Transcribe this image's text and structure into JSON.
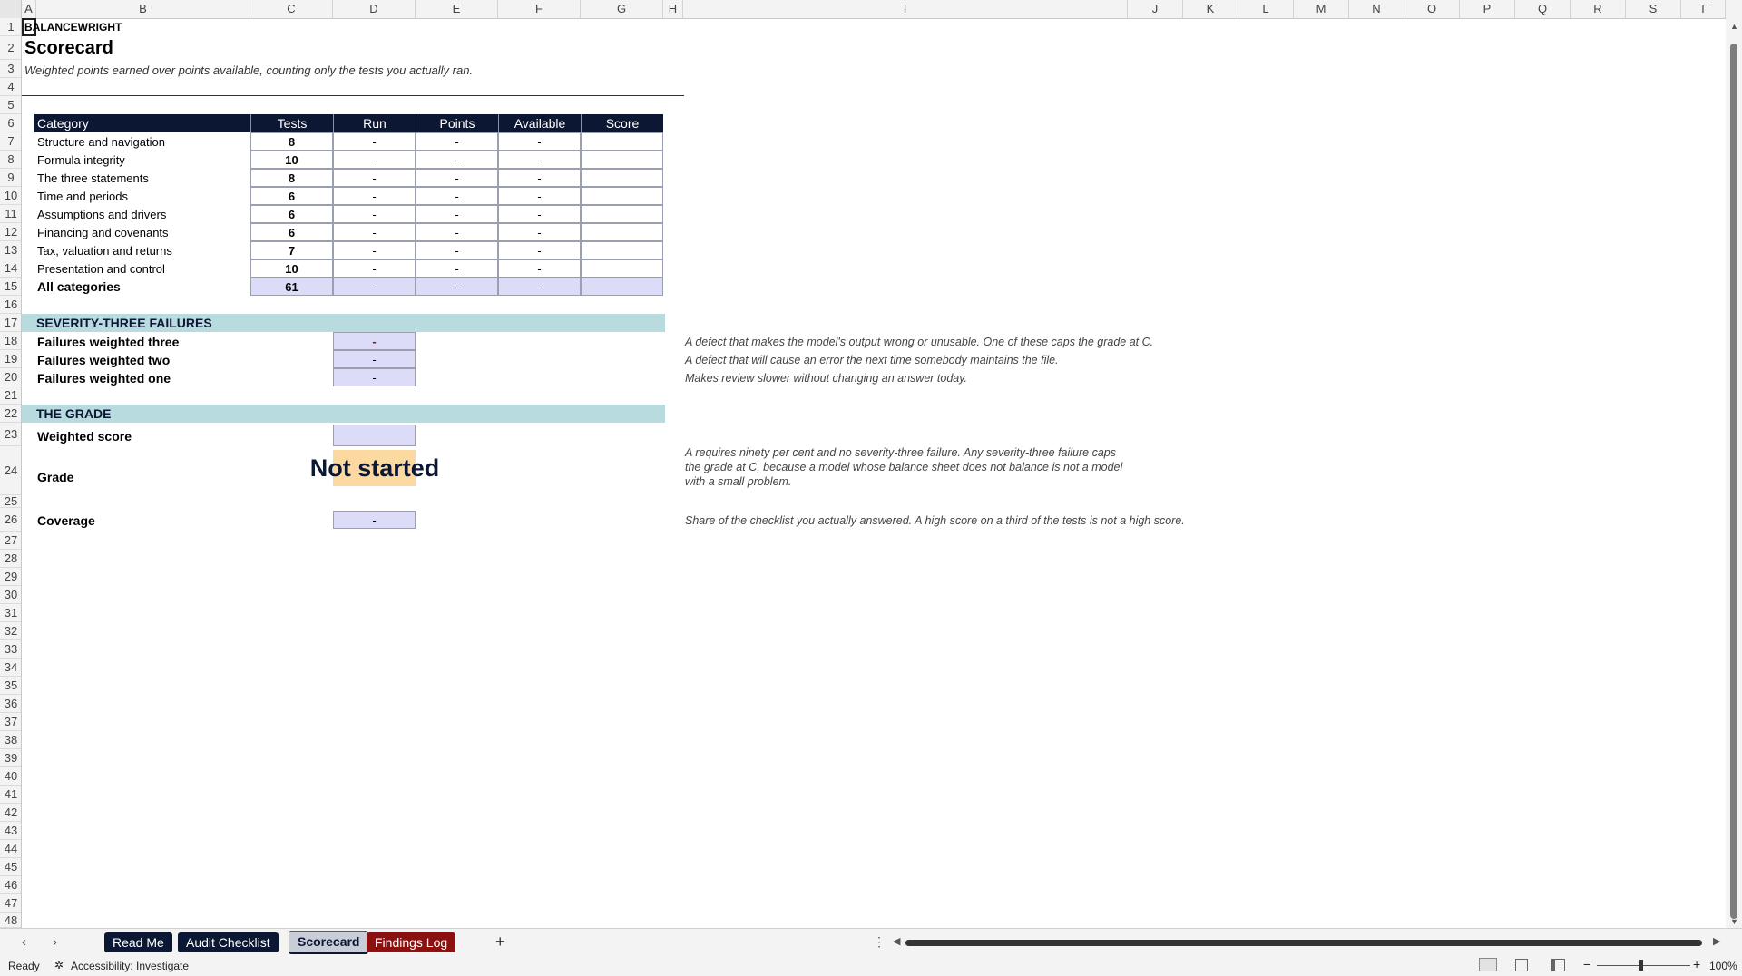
{
  "columns": [
    "A",
    "B",
    "C",
    "D",
    "E",
    "F",
    "G",
    "H",
    "I",
    "J",
    "K",
    "L",
    "M",
    "N",
    "O",
    "P",
    "Q",
    "R",
    "S",
    "T"
  ],
  "rows": [
    "1",
    "2",
    "3",
    "4",
    "5",
    "6",
    "7",
    "8",
    "9",
    "10",
    "11",
    "12",
    "13",
    "14",
    "15",
    "16",
    "17",
    "18",
    "19",
    "20",
    "21",
    "22",
    "23",
    "24",
    "25",
    "26",
    "27",
    "28",
    "29",
    "30",
    "31",
    "32",
    "33",
    "34",
    "35",
    "36",
    "37",
    "38",
    "39",
    "40",
    "41",
    "42",
    "43",
    "44",
    "45",
    "46",
    "47",
    "48"
  ],
  "sheet": {
    "brand": "BALANCEWRIGHT",
    "title": "Scorecard",
    "subtitle": "Weighted points earned over points available, counting only the tests you actually ran.",
    "table": {
      "headers": [
        "Category",
        "Tests",
        "Run",
        "Points",
        "Available",
        "Score"
      ],
      "rows": [
        {
          "category": "Structure and navigation",
          "tests": "8",
          "run": "-",
          "points": "-",
          "available": "-",
          "score": ""
        },
        {
          "category": "Formula integrity",
          "tests": "10",
          "run": "-",
          "points": "-",
          "available": "-",
          "score": ""
        },
        {
          "category": "The three statements",
          "tests": "8",
          "run": "-",
          "points": "-",
          "available": "-",
          "score": ""
        },
        {
          "category": "Time and periods",
          "tests": "6",
          "run": "-",
          "points": "-",
          "available": "-",
          "score": ""
        },
        {
          "category": "Assumptions and drivers",
          "tests": "6",
          "run": "-",
          "points": "-",
          "available": "-",
          "score": ""
        },
        {
          "category": "Financing and covenants",
          "tests": "6",
          "run": "-",
          "points": "-",
          "available": "-",
          "score": ""
        },
        {
          "category": "Tax, valuation and returns",
          "tests": "7",
          "run": "-",
          "points": "-",
          "available": "-",
          "score": ""
        },
        {
          "category": "Presentation and control",
          "tests": "10",
          "run": "-",
          "points": "-",
          "available": "-",
          "score": ""
        }
      ],
      "total": {
        "category": "All categories",
        "tests": "61",
        "run": "-",
        "points": "-",
        "available": "-",
        "score": ""
      }
    },
    "severity": {
      "heading": "SEVERITY-THREE FAILURES",
      "items": [
        {
          "label": "Failures weighted three",
          "value": "-",
          "note": "A defect that makes the model's output wrong or unusable. One of these caps the grade at C."
        },
        {
          "label": "Failures weighted two",
          "value": "-",
          "note": "A defect that will cause an error the next time somebody maintains the file."
        },
        {
          "label": "Failures weighted one",
          "value": "-",
          "note": "Makes review slower without changing an answer today."
        }
      ]
    },
    "grade": {
      "heading": "THE GRADE",
      "weighted_label": "Weighted score",
      "weighted_value": "",
      "grade_label": "Grade",
      "grade_value": "Not started",
      "grade_note": [
        "A requires ninety per cent and no severity-three failure. Any severity-three failure caps",
        "the grade at C, because a model whose balance sheet does not balance is not a model",
        "with a small problem."
      ],
      "coverage_label": "Coverage",
      "coverage_value": "-",
      "coverage_note": "Share of the checklist you actually answered. A high score on a third of the tests is not a high score."
    }
  },
  "tabs": [
    {
      "label": "Read Me",
      "color": "#0b1733"
    },
    {
      "label": "Audit Checklist",
      "color": "#0b1733"
    },
    {
      "label": "Scorecard",
      "color": "#c9cdd8"
    },
    {
      "label": "Findings Log",
      "color": "#8b1010"
    }
  ],
  "tab_add": "+",
  "status": {
    "ready": "Ready",
    "accessibility": "Accessibility: Investigate",
    "zoom": "100%"
  },
  "colors": {
    "header_navy": "#0b1733",
    "band_teal": "#b8dbe0",
    "input_lavender": "#dcdcf8",
    "grade_orange": "#fcd9a0",
    "findings_red": "#8b1010"
  }
}
